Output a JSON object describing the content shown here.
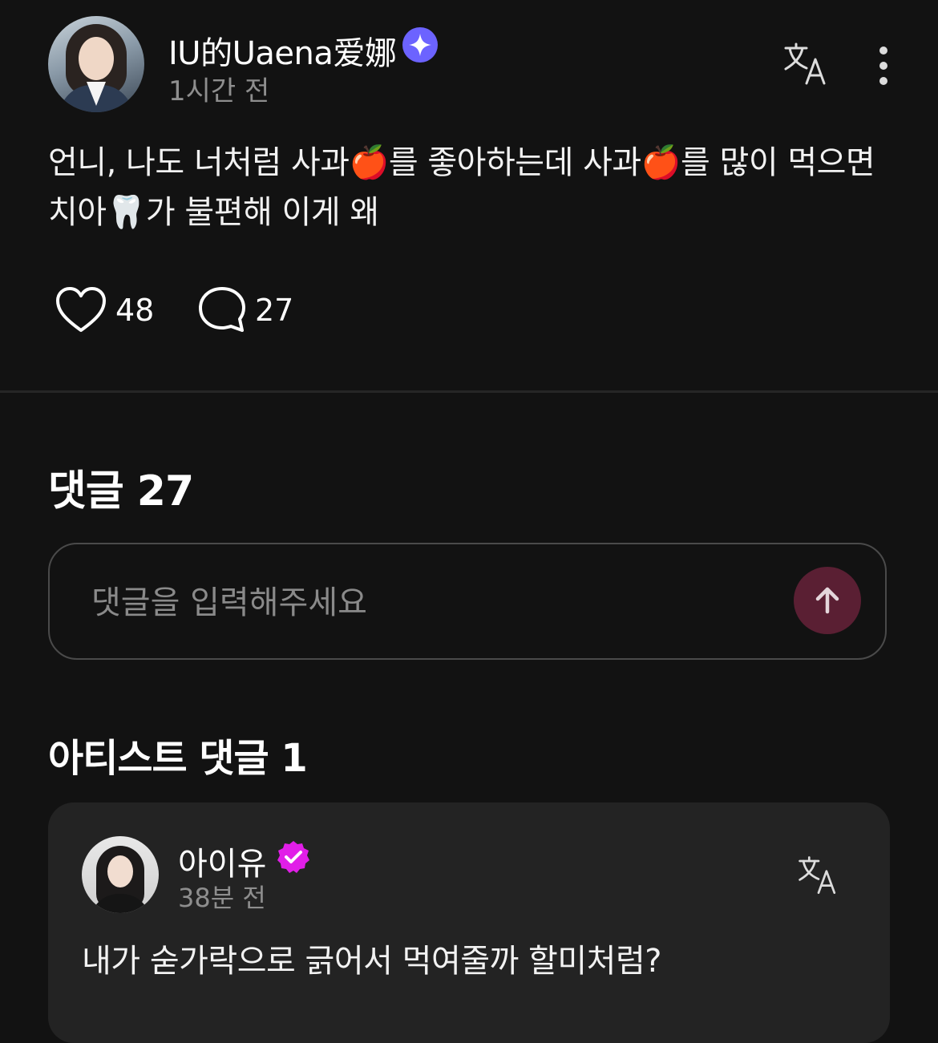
{
  "post": {
    "author_name": "IU的Uaena爱娜",
    "author_badge_icon": "sparkle-badge-icon",
    "time": "1시간 전",
    "body": "언니, 나도 너처럼 사과🍎를 좋아하는데 사과🍎를 많이 먹으면 치아🦷가 불편해 이게 왜",
    "likes": "48",
    "comments": "27",
    "translate_icon": "translate-icon",
    "more_icon": "more-vertical-icon"
  },
  "comments_section": {
    "title": "댓글 27",
    "input_placeholder": "댓글을 입력해주세요",
    "send_icon": "arrow-up-icon"
  },
  "artist_comments": {
    "title": "아티스트 댓글 1",
    "items": [
      {
        "name": "아이유",
        "badge_icon": "verified-badge-icon",
        "time": "38분 전",
        "text": "내가 숟가락으로 긁어서 먹여줄까 할미처럼?"
      }
    ]
  },
  "colors": {
    "background": "#121212",
    "card": "#232323",
    "send_button": "#5a1f33",
    "sparkle_badge": "#6c63ff",
    "verified_badge": "#e11ee8",
    "muted_text": "#8e8e8e"
  }
}
